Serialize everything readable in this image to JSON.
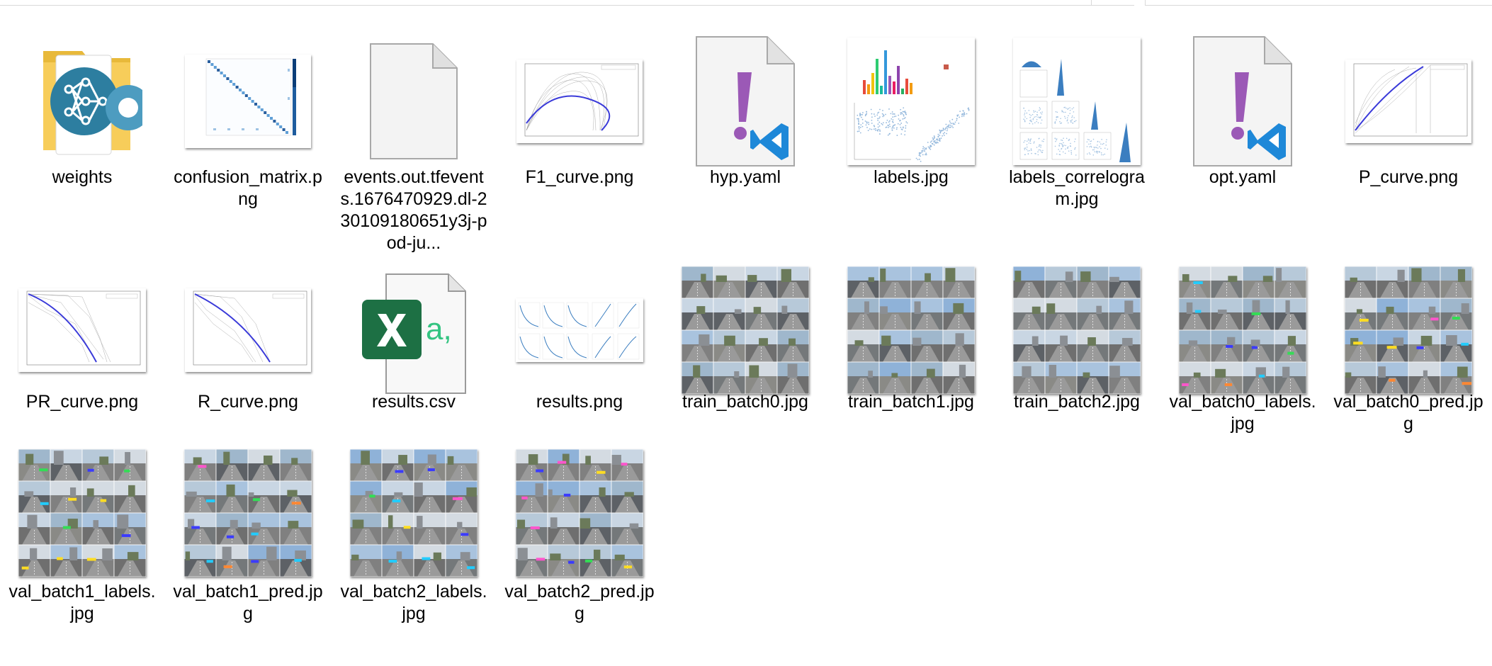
{
  "files": [
    {
      "name": "weights",
      "icon": "folder-icon"
    },
    {
      "name": "confusion_matrix.png",
      "icon": "confusion-matrix-thumbnail"
    },
    {
      "name": "events.out.tfevents.1676470929.dl-230109180651y3j-pod-ju...",
      "icon": "blank-file-icon"
    },
    {
      "name": "F1_curve.png",
      "icon": "f1-curve-thumbnail"
    },
    {
      "name": "hyp.yaml",
      "icon": "vscode-yaml-icon"
    },
    {
      "name": "labels.jpg",
      "icon": "labels-thumbnail"
    },
    {
      "name": "labels_correlogram.jpg",
      "icon": "correlogram-thumbnail"
    },
    {
      "name": "opt.yaml",
      "icon": "vscode-yaml-icon"
    },
    {
      "name": "P_curve.png",
      "icon": "p-curve-thumbnail"
    },
    {
      "name": "PR_curve.png",
      "icon": "pr-curve-thumbnail"
    },
    {
      "name": "R_curve.png",
      "icon": "r-curve-thumbnail"
    },
    {
      "name": "results.csv",
      "icon": "excel-csv-icon"
    },
    {
      "name": "results.png",
      "icon": "results-thumbnail"
    },
    {
      "name": "train_batch0.jpg",
      "icon": "image-grid-thumbnail"
    },
    {
      "name": "train_batch1.jpg",
      "icon": "image-grid-thumbnail"
    },
    {
      "name": "train_batch2.jpg",
      "icon": "image-grid-thumbnail"
    },
    {
      "name": "val_batch0_labels.jpg",
      "icon": "image-grid-thumbnail"
    },
    {
      "name": "val_batch0_pred.jpg",
      "icon": "image-grid-thumbnail"
    },
    {
      "name": "val_batch1_labels.jpg",
      "icon": "image-grid-thumbnail"
    },
    {
      "name": "val_batch1_pred.jpg",
      "icon": "image-grid-thumbnail"
    },
    {
      "name": "val_batch2_labels.jpg",
      "icon": "image-grid-thumbnail"
    },
    {
      "name": "val_batch2_pred.jpg",
      "icon": "image-grid-thumbnail"
    }
  ],
  "colors": {
    "folder": "#f5c84c",
    "excel_green": "#1d7044",
    "excel_teal": "#33c481",
    "yaml_mark": "#9b59b6",
    "vscode_blue": "#1e88d8",
    "curve_blue": "#3a3ad9"
  }
}
